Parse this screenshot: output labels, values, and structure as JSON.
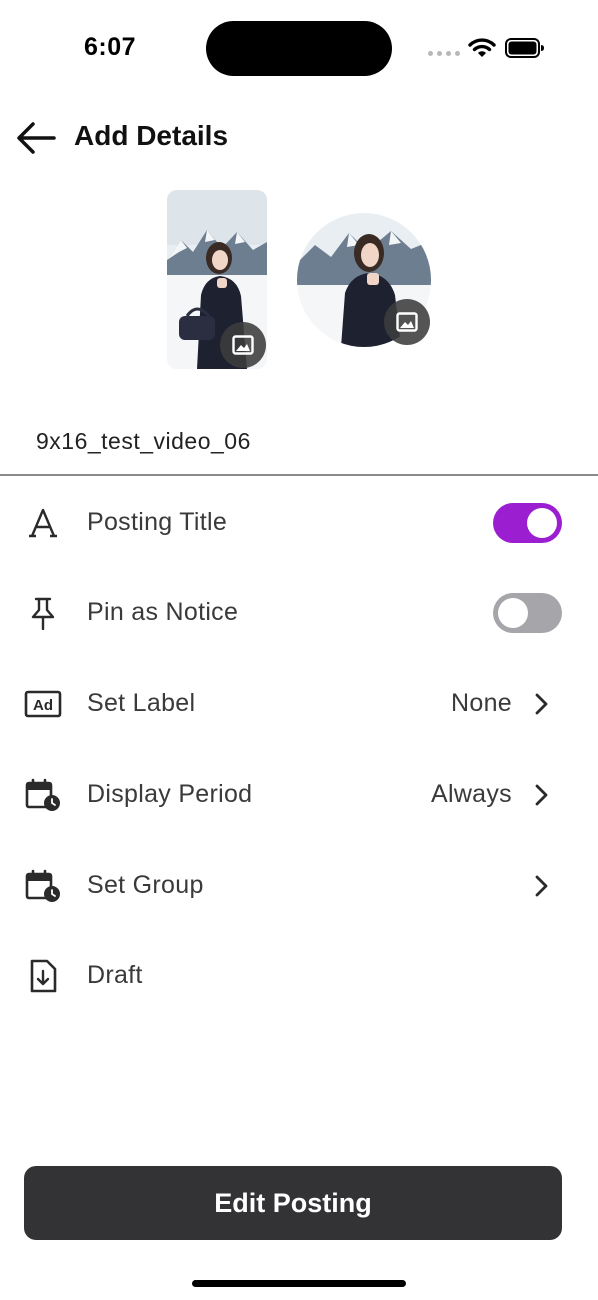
{
  "status_bar": {
    "time": "6:07"
  },
  "header": {
    "title": "Add Details"
  },
  "video": {
    "file_name": "9x16_test_video_06"
  },
  "settings": [
    {
      "id": "posting-title",
      "label": "Posting Title",
      "icon": "text-a-icon",
      "control": "toggle",
      "toggle_on": true
    },
    {
      "id": "pin-as-notice",
      "label": "Pin as Notice",
      "icon": "pin-icon",
      "control": "toggle",
      "toggle_on": false
    },
    {
      "id": "set-label",
      "label": "Set Label",
      "icon": "ad-label-icon",
      "control": "chevron",
      "value": "None"
    },
    {
      "id": "display-period",
      "label": "Display Period",
      "icon": "calendar-clock-icon",
      "control": "chevron",
      "value": "Always"
    },
    {
      "id": "set-group",
      "label": "Set Group",
      "icon": "calendar-clock-icon",
      "control": "chevron",
      "value": ""
    },
    {
      "id": "draft",
      "label": "Draft",
      "icon": "file-download-icon",
      "control": "none"
    }
  ],
  "footer": {
    "button_label": "Edit Posting"
  },
  "colors": {
    "toggle_on": "#9b1fd1",
    "toggle_off": "#a6a6aa",
    "primary_button": "#333336"
  }
}
